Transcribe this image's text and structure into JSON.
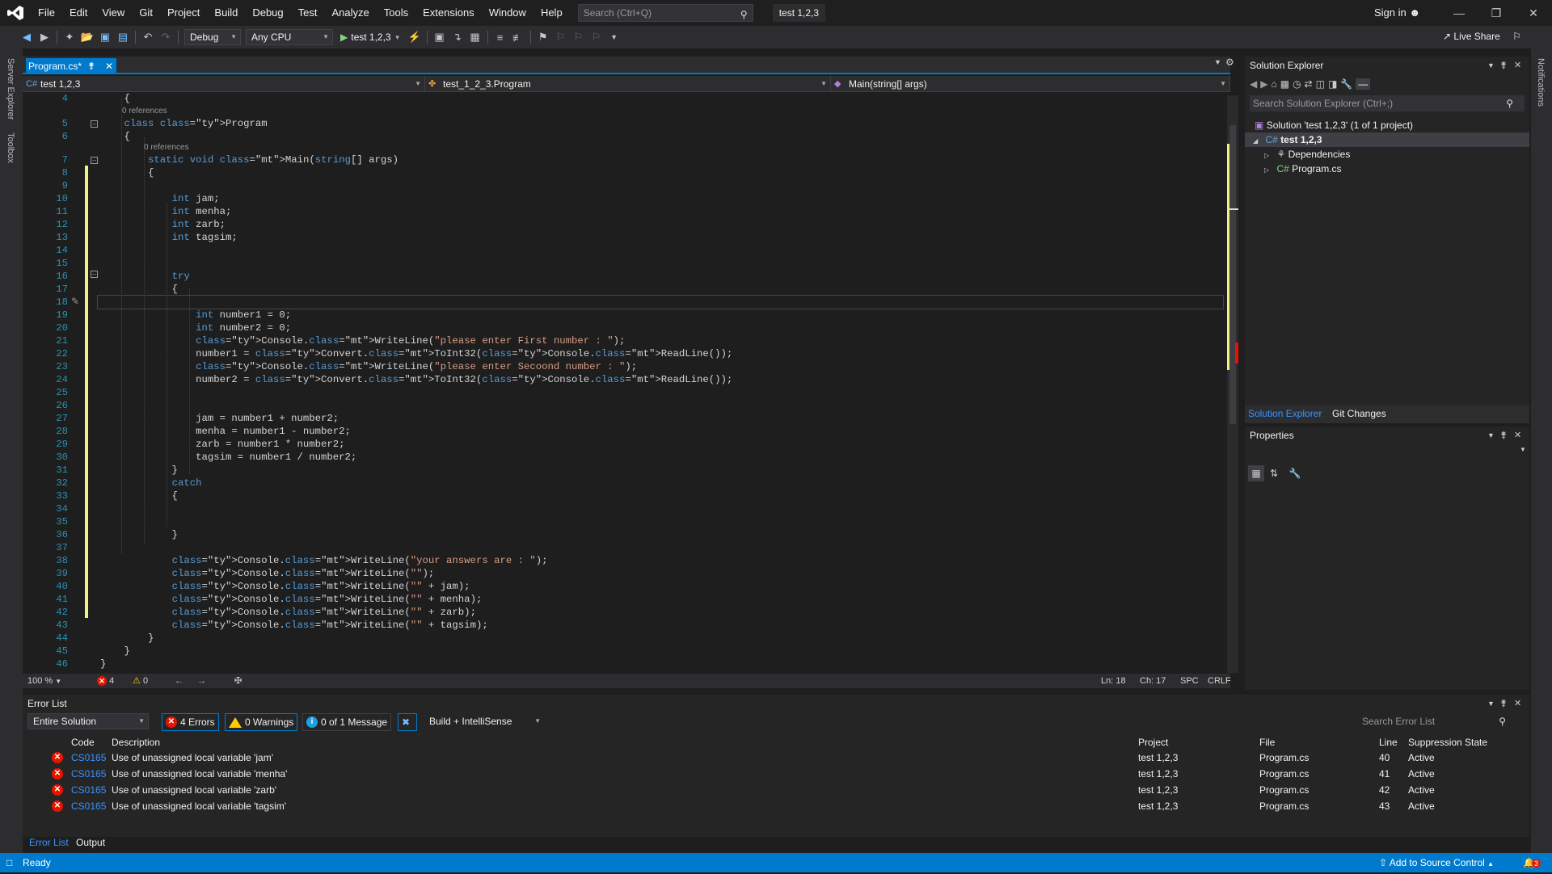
{
  "app": {
    "title": "test 1,2,3",
    "signin": "Sign in",
    "liveshare": "Live Share"
  },
  "menu": [
    "File",
    "Edit",
    "View",
    "Git",
    "Project",
    "Build",
    "Debug",
    "Test",
    "Analyze",
    "Tools",
    "Extensions",
    "Window",
    "Help"
  ],
  "search": {
    "placeholder": "Search (Ctrl+Q)"
  },
  "toolbar": {
    "config": "Debug",
    "platform": "Any CPU",
    "run_target": "test 1,2,3"
  },
  "side_tabs": {
    "left": [
      "Server Explorer",
      "Toolbox"
    ],
    "right": "Notifications"
  },
  "editor": {
    "tab": "Program.cs*",
    "nav": {
      "project": "test 1,2,3",
      "class": "test_1_2_3.Program",
      "member": "Main(string[] args)"
    },
    "refs_label": "0 references",
    "lines": [
      {
        "n": "4",
        "t": "    {"
      },
      {
        "n": "5",
        "t": "    class Program"
      },
      {
        "n": "6",
        "t": "    {"
      },
      {
        "n": "7",
        "t": "        static void Main(string[] args)"
      },
      {
        "n": "8",
        "t": "        {"
      },
      {
        "n": "9",
        "t": ""
      },
      {
        "n": "10",
        "t": "            int jam;"
      },
      {
        "n": "11",
        "t": "            int menha;"
      },
      {
        "n": "12",
        "t": "            int zarb;"
      },
      {
        "n": "13",
        "t": "            int tagsim;"
      },
      {
        "n": "14",
        "t": ""
      },
      {
        "n": "15",
        "t": ""
      },
      {
        "n": "16",
        "t": "            try"
      },
      {
        "n": "17",
        "t": "            {"
      },
      {
        "n": "18",
        "t": ""
      },
      {
        "n": "19",
        "t": "                int number1 = 0;"
      },
      {
        "n": "20",
        "t": "                int number2 = 0;"
      },
      {
        "n": "21",
        "t": "                Console.WriteLine(\"please enter First number : \");"
      },
      {
        "n": "22",
        "t": "                number1 = Convert.ToInt32(Console.ReadLine());"
      },
      {
        "n": "23",
        "t": "                Console.WriteLine(\"please enter Secoond number : \");"
      },
      {
        "n": "24",
        "t": "                number2 = Convert.ToInt32(Console.ReadLine());"
      },
      {
        "n": "25",
        "t": ""
      },
      {
        "n": "26",
        "t": ""
      },
      {
        "n": "27",
        "t": "                jam = number1 + number2;"
      },
      {
        "n": "28",
        "t": "                menha = number1 - number2;"
      },
      {
        "n": "29",
        "t": "                zarb = number1 * number2;"
      },
      {
        "n": "30",
        "t": "                tagsim = number1 / number2;"
      },
      {
        "n": "31",
        "t": "            }"
      },
      {
        "n": "32",
        "t": "            catch"
      },
      {
        "n": "33",
        "t": "            {"
      },
      {
        "n": "34",
        "t": ""
      },
      {
        "n": "35",
        "t": ""
      },
      {
        "n": "36",
        "t": "            }"
      },
      {
        "n": "37",
        "t": ""
      },
      {
        "n": "38",
        "t": "            Console.WriteLine(\"your answers are : \");"
      },
      {
        "n": "39",
        "t": "            Console.WriteLine(\"\");"
      },
      {
        "n": "40",
        "t": "            Console.WriteLine(\"\" + jam);"
      },
      {
        "n": "41",
        "t": "            Console.WriteLine(\"\" + menha);"
      },
      {
        "n": "42",
        "t": "            Console.WriteLine(\"\" + zarb);"
      },
      {
        "n": "43",
        "t": "            Console.WriteLine(\"\" + tagsim);"
      },
      {
        "n": "44",
        "t": "        }"
      },
      {
        "n": "45",
        "t": "    }"
      },
      {
        "n": "46",
        "t": "}"
      }
    ],
    "status": {
      "zoom": "100 %",
      "errors": "4",
      "warnings": "0",
      "ln": "Ln: 18",
      "ch": "Ch: 17",
      "enc": "SPC",
      "eol": "CRLF"
    }
  },
  "solution_explorer": {
    "title": "Solution Explorer",
    "search_placeholder": "Search Solution Explorer (Ctrl+;)",
    "tree": {
      "solution": "Solution 'test 1,2,3' (1 of 1 project)",
      "project": "test 1,2,3",
      "dependencies": "Dependencies",
      "file": "Program.cs"
    },
    "tabs": [
      "Solution Explorer",
      "Git Changes"
    ]
  },
  "properties": {
    "title": "Properties"
  },
  "error_list": {
    "title": "Error List",
    "scope": "Entire Solution",
    "errors_btn": "4 Errors",
    "warnings_btn": "0 Warnings",
    "messages_btn": "0 of 1 Message",
    "source": "Build + IntelliSense",
    "search_placeholder": "Search Error List",
    "columns": [
      "Code",
      "Description",
      "Project",
      "File",
      "Line",
      "Suppression State"
    ],
    "rows": [
      {
        "code": "CS0165",
        "desc": "Use of unassigned local variable 'jam'",
        "project": "test 1,2,3",
        "file": "Program.cs",
        "line": "40",
        "state": "Active"
      },
      {
        "code": "CS0165",
        "desc": "Use of unassigned local variable 'menha'",
        "project": "test 1,2,3",
        "file": "Program.cs",
        "line": "41",
        "state": "Active"
      },
      {
        "code": "CS0165",
        "desc": "Use of unassigned local variable 'zarb'",
        "project": "test 1,2,3",
        "file": "Program.cs",
        "line": "42",
        "state": "Active"
      },
      {
        "code": "CS0165",
        "desc": "Use of unassigned local variable 'tagsim'",
        "project": "test 1,2,3",
        "file": "Program.cs",
        "line": "43",
        "state": "Active"
      }
    ],
    "bottom_tabs": [
      "Error List",
      "Output"
    ]
  },
  "statusbar": {
    "ready": "Ready",
    "source_control": "Add to Source Control",
    "notif_count": "3"
  },
  "colors": {
    "accent": "#007acc",
    "error": "#e51400",
    "warning": "#ffcc00",
    "keyword": "#569cd6",
    "type": "#4ec9b0",
    "string": "#d69d85",
    "method": "#dcdcaa",
    "linenum": "#2b91af"
  }
}
